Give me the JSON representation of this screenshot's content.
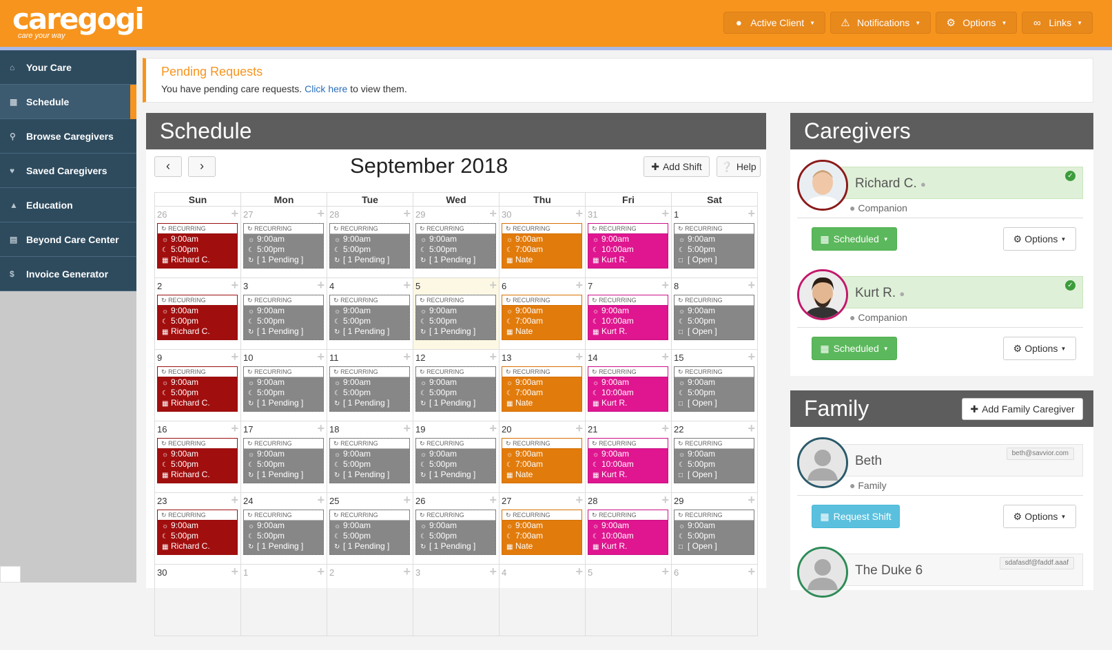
{
  "brand": {
    "name": "caregogi",
    "tagline": "care your way"
  },
  "topnav": [
    {
      "label": "Active Client",
      "icon": "person-icon"
    },
    {
      "label": "Notifications",
      "icon": "warning-icon"
    },
    {
      "label": "Options",
      "icon": "gear-icon"
    },
    {
      "label": "Links",
      "icon": "link-icon"
    }
  ],
  "sidebar": [
    {
      "label": "Your Care",
      "icon": "home-icon",
      "active": false
    },
    {
      "label": "Schedule",
      "icon": "calendar-icon",
      "active": true
    },
    {
      "label": "Browse Caregivers",
      "icon": "search-icon",
      "active": false
    },
    {
      "label": "Saved Caregivers",
      "icon": "heart-icon",
      "active": false
    },
    {
      "label": "Education",
      "icon": "graduation-cap-icon",
      "active": false
    },
    {
      "label": "Beyond Care Center",
      "icon": "book-icon",
      "active": false
    },
    {
      "label": "Invoice Generator",
      "icon": "dollar-icon",
      "active": false
    }
  ],
  "alert": {
    "title": "Pending Requests",
    "text_before": "You have pending care requests.",
    "link": "Click here",
    "text_after": "to view them."
  },
  "schedule": {
    "title": "Schedule",
    "month": "September 2018",
    "add_shift": "Add Shift",
    "help": "Help",
    "weekdays": [
      "Sun",
      "Mon",
      "Tue",
      "Wed",
      "Thu",
      "Fri",
      "Sat"
    ],
    "recurring_label": "RECURRING",
    "weeks": [
      [
        "26",
        "27",
        "28",
        "29",
        "30",
        "31",
        "1"
      ],
      [
        "2",
        "3",
        "4",
        "5",
        "6",
        "7",
        "8"
      ],
      [
        "9",
        "10",
        "11",
        "12",
        "13",
        "14",
        "15"
      ],
      [
        "16",
        "17",
        "18",
        "19",
        "20",
        "21",
        "22"
      ],
      [
        "23",
        "24",
        "25",
        "26",
        "27",
        "28",
        "29"
      ],
      [
        "30",
        "1",
        "2",
        "3",
        "4",
        "5",
        "6"
      ]
    ],
    "today": "5",
    "shift_templates": [
      {
        "color": "#a10e0e",
        "start": "9:00am",
        "end": "5:00pm",
        "who": "Richard C."
      },
      {
        "color": "#878787",
        "start": "9:00am",
        "end": "5:00pm",
        "who": "[ 1 Pending ]"
      },
      {
        "color": "#878787",
        "start": "9:00am",
        "end": "5:00pm",
        "who": "[ 1 Pending ]"
      },
      {
        "color": "#878787",
        "start": "9:00am",
        "end": "5:00pm",
        "who": "[ 1 Pending ]"
      },
      {
        "color": "#e17b0c",
        "start": "9:00am",
        "end": "7:00am",
        "who": "Nate"
      },
      {
        "color": "#df168f",
        "start": "9:00am",
        "end": "10:00am",
        "who": "Kurt R."
      },
      {
        "color": "#878787",
        "start": "9:00am",
        "end": "5:00pm",
        "who": "[ Open ]"
      }
    ]
  },
  "caregivers": {
    "title": "Caregivers",
    "items": [
      {
        "name": "Richard C.",
        "role": "Companion",
        "status": "Scheduled",
        "options": "Options"
      },
      {
        "name": "Kurt R.",
        "role": "Companion",
        "status": "Scheduled",
        "options": "Options"
      }
    ]
  },
  "family": {
    "title": "Family",
    "add_label": "Add Family Caregiver",
    "items": [
      {
        "name": "Beth",
        "role": "Family",
        "email": "beth@savvior.com",
        "action": "Request Shift",
        "options": "Options"
      },
      {
        "name": "The Duke 6",
        "role": "",
        "email": "sdafasdf@faddf.aaaf",
        "action": "",
        "options": ""
      }
    ]
  }
}
